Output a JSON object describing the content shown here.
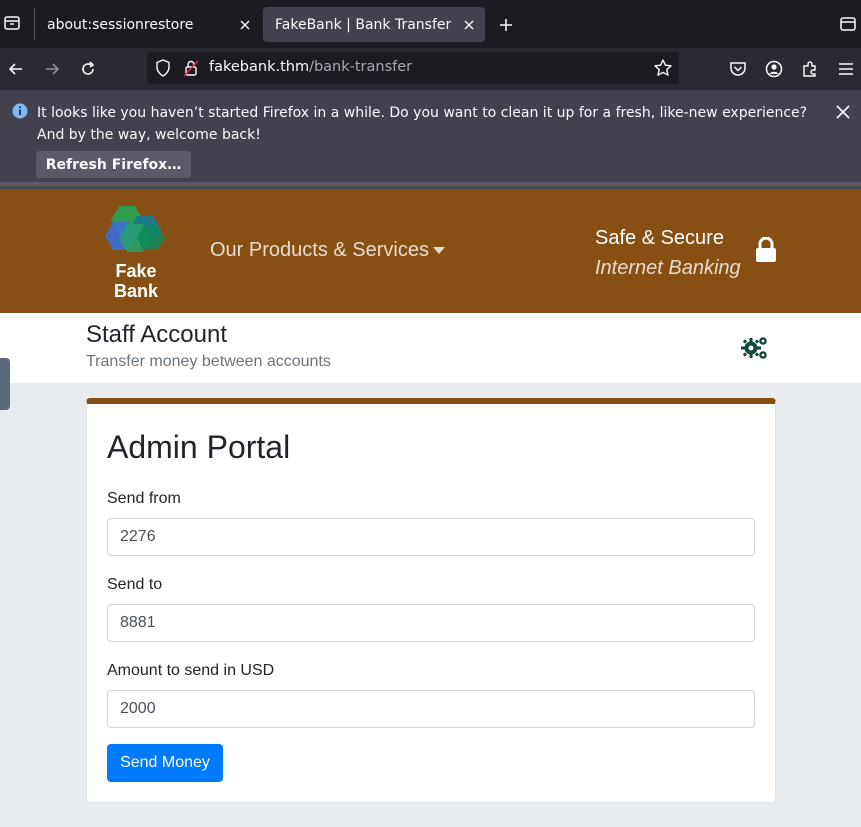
{
  "browser": {
    "tabs": [
      {
        "title": "about:sessionrestore",
        "active": false
      },
      {
        "title": "FakeBank | Bank Transfer",
        "active": true
      }
    ],
    "url_host": "fakebank.thm",
    "url_path": "/bank-transfer",
    "infobar": {
      "message": "It looks like you haven’t started Firefox in a while. Do you want to clean it up for a fresh, like-new experience? And by the way, welcome back!",
      "button_label": "Refresh Firefox…"
    }
  },
  "site": {
    "logo_line1": "Fake",
    "logo_line2": "Bank",
    "nav_products": "Our Products & Services",
    "tagline_line1": "Safe & Secure",
    "tagline_line2": "Internet Banking",
    "brand_color": "#884f14"
  },
  "subheader": {
    "title": "Staff Account",
    "subtitle": "Transfer money between accounts"
  },
  "form": {
    "heading": "Admin Portal",
    "send_from_label": "Send from",
    "send_from_value": "2276",
    "send_to_label": "Send to",
    "send_to_value": "8881",
    "amount_label": "Amount to send in USD",
    "amount_value": "2000",
    "submit_label": "Send Money"
  }
}
